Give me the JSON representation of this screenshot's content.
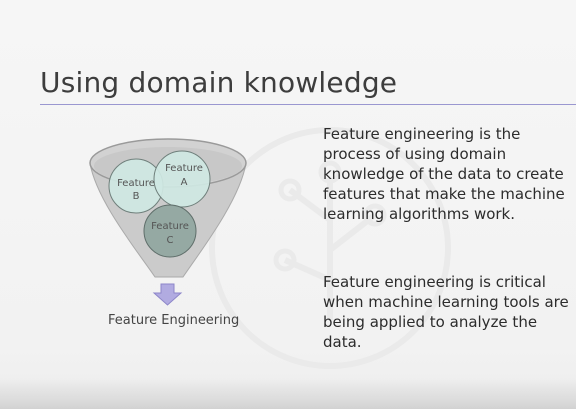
{
  "slide": {
    "title": "Using domain knowledge",
    "paragraphs": [
      "Feature engineering is the process of using domain knowledge of the data to create features that make the machine learning algorithms work.",
      "Feature engineering is critical when machine learning tools are being applied to analyze the data."
    ]
  },
  "diagram": {
    "circles": [
      {
        "line1": "Feature",
        "line2": "B"
      },
      {
        "line1": "Feature",
        "line2": "A"
      },
      {
        "line1": "Feature",
        "line2": "C"
      }
    ],
    "caption": "Feature Engineering"
  },
  "colors": {
    "funnel_fill": "#cbcbcb",
    "funnel_rim": "#9a9a9a",
    "circle_ab": "#cfe8e3",
    "circle_c": "#8fa59f",
    "arrow": "#b1abe1",
    "rule": "#9a97d0"
  }
}
